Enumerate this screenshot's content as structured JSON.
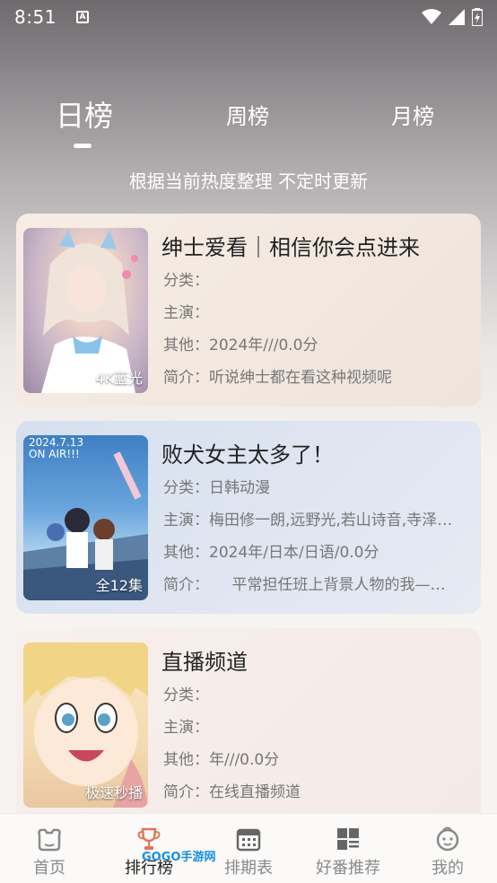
{
  "status_bar": {
    "time": "8:51",
    "a_badge": "A"
  },
  "tabs": [
    {
      "label": "日榜",
      "active": true
    },
    {
      "label": "周榜",
      "active": false
    },
    {
      "label": "月榜",
      "active": false
    }
  ],
  "subtitle": "根据当前热度整理 不定时更新",
  "cards": [
    {
      "title": "绅士爱看｜相信你会点进来",
      "cover_tag": "4K蓝光",
      "category_label": "分类：",
      "category": "",
      "cast_label": "主演：",
      "cast": "",
      "other_label": "其他：",
      "other": "2024年///0.0分",
      "intro_label": "简介：",
      "intro": "听说绅士都在看这种视频呢",
      "bg": "#f5ebe3"
    },
    {
      "title": "败犬女主太多了！",
      "cover_tag": "全12集",
      "cover_text_1": "2024.7.13",
      "cover_text_2": "ON AIR!!!",
      "category_label": "分类：",
      "category": "日韩动漫",
      "cast_label": "主演：",
      "cast": "梅田修一朗,远野光,若山诗音,寺泽…",
      "other_label": "其他：",
      "other": "2024年/日本/日语/0.0分",
      "intro_label": "简介：",
      "intro": "　　平常担任班上背景人物的我—…",
      "bg": "#dfe6f2"
    },
    {
      "title": "直播频道",
      "cover_tag": "极速秒播",
      "category_label": "分类：",
      "category": "",
      "cast_label": "主演：",
      "cast": "",
      "other_label": "其他：",
      "other": "年///0.0分",
      "intro_label": "简介：",
      "intro": "在线直播频道",
      "bg": "#f7efec"
    }
  ],
  "bottom_nav": [
    {
      "label": "首页",
      "icon": "bear-icon"
    },
    {
      "label": "排行榜",
      "icon": "trophy-icon",
      "active": true
    },
    {
      "label": "排期表",
      "icon": "calendar-icon"
    },
    {
      "label": "好番推荐",
      "icon": "grid-icon"
    },
    {
      "label": "我的",
      "icon": "baby-icon"
    }
  ],
  "watermark": "GOGO手游网",
  "colors": {
    "active_nav": "#e0765a",
    "inactive_nav": "#8a8a8a",
    "watermark": "#1a8de0"
  }
}
